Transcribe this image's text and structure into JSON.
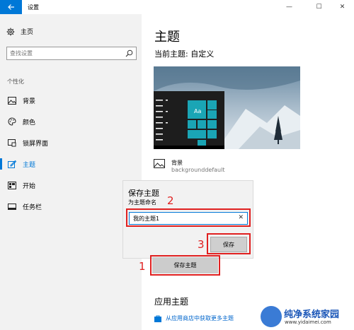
{
  "window": {
    "title": "设置",
    "back_icon": "back-arrow-icon",
    "minimize": "—",
    "maximize": "☐",
    "close": "✕"
  },
  "sidebar": {
    "home_label": "主页",
    "search_placeholder": "查找设置",
    "section_label": "个性化",
    "items": [
      {
        "label": "背景",
        "icon": "picture-icon"
      },
      {
        "label": "颜色",
        "icon": "palette-icon"
      },
      {
        "label": "锁屏界面",
        "icon": "lock-screen-icon"
      },
      {
        "label": "主题",
        "icon": "theme-icon",
        "active": true
      },
      {
        "label": "开始",
        "icon": "start-icon"
      },
      {
        "label": "任务栏",
        "icon": "taskbar-icon"
      }
    ]
  },
  "main": {
    "page_title": "主题",
    "current_theme": "当前主题: 自定义",
    "preview_tile_text": "Aa",
    "background_label": "背景",
    "background_value": "backgrounddefault",
    "save_theme_button": "保存主题",
    "apply_title": "应用主题",
    "store_link": "从应用商店中获取更多主题"
  },
  "dialog": {
    "title": "保存主题",
    "subtitle": "为主题命名",
    "input_value": "我的主题1",
    "clear_icon": "✕",
    "save_button": "保存"
  },
  "annotations": {
    "n1": "1",
    "n2": "2",
    "n3": "3"
  },
  "watermark": {
    "title": "纯净系统家园",
    "url": "www.yidaimei.com"
  },
  "colors": {
    "accent": "#0078d7",
    "annotation": "#e02020",
    "sidebar_bg": "#f2f2f2"
  }
}
